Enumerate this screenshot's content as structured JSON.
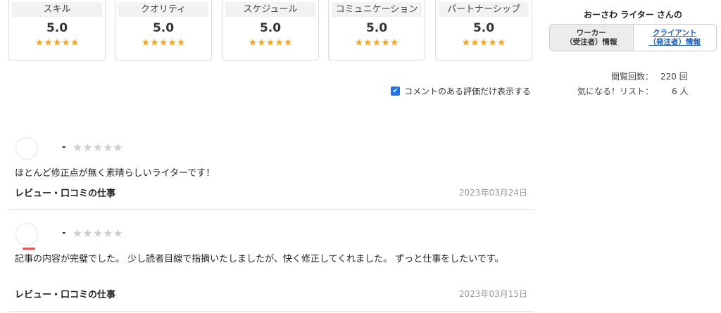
{
  "rating_cards": [
    {
      "label": "スキル",
      "value": "5.0",
      "stars": "★★★★★"
    },
    {
      "label": "クオリティ",
      "value": "5.0",
      "stars": "★★★★★"
    },
    {
      "label": "スケジュール",
      "value": "5.0",
      "stars": "★★★★★"
    },
    {
      "label": "コミュニケーション",
      "value": "5.0",
      "stars": "★★★★★"
    },
    {
      "label": "パートナーシップ",
      "value": "5.0",
      "stars": "★★★★★"
    }
  ],
  "filter": {
    "checked": true,
    "check_icon": "✔",
    "label": "コメントのある評価だけ表示する"
  },
  "sidebar": {
    "title": "おーさわ ライター さんの",
    "tabs": [
      {
        "line1": "ワーカー",
        "line2": "（受注者）情報",
        "active": true
      },
      {
        "line1": "クライアント",
        "line2": "（発注者）情報",
        "active": false
      }
    ],
    "stats": [
      {
        "label": "閲覧回数：",
        "value": "220 回"
      },
      {
        "label": "気になる！リスト：",
        "value": "6 人"
      }
    ]
  },
  "reviews": [
    {
      "reviewer": "-",
      "stars": "★★★★★",
      "comment": "ほとんど修正点が無く素晴らしいライターです！",
      "job": "レビュー・口コミの仕事",
      "date": "2023年03月24日"
    },
    {
      "reviewer": "-",
      "stars": "★★★★★",
      "comment": "記事の内容が完璧でした。 少し読者目線で指摘いたしましたが、快く修正してくれました。 ずっと仕事をしたいです。",
      "job": "レビュー・口コミの仕事",
      "date": "2023年03月15日"
    }
  ],
  "colors": {
    "star_gold": "#f5a623",
    "star_gray": "#cfcfcf",
    "link_blue": "#1a5fb4",
    "checkbox_blue": "#1a73e8"
  }
}
